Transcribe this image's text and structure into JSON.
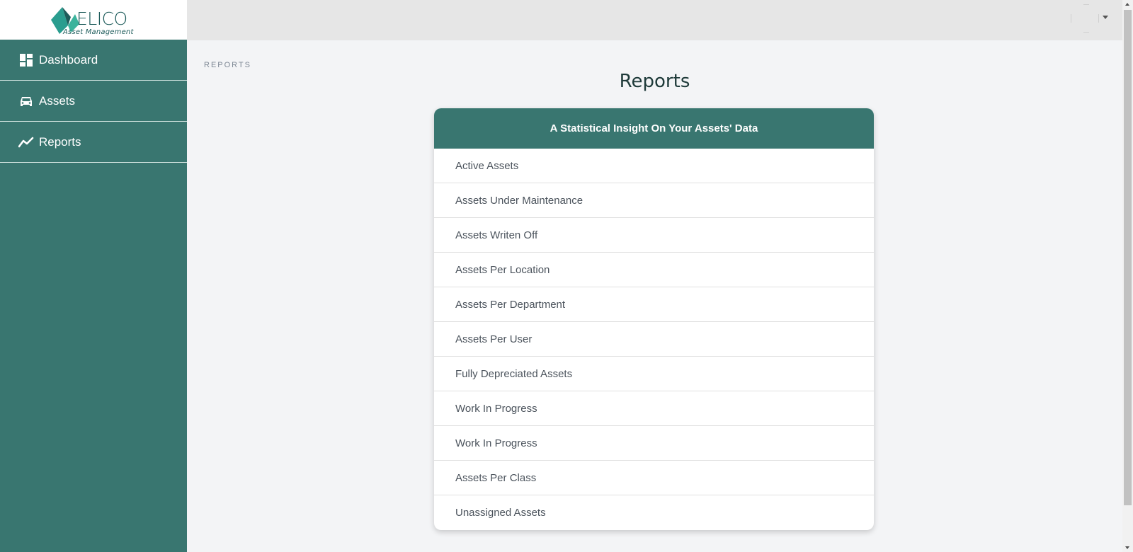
{
  "logo": {
    "word": "ELICO",
    "subtitle": "Asset Management"
  },
  "sidebar": {
    "items": [
      {
        "label": "Dashboard",
        "icon": "dashboard-icon"
      },
      {
        "label": "Assets",
        "icon": "car-icon"
      },
      {
        "label": "Reports",
        "icon": "trend-line-icon"
      }
    ]
  },
  "breadcrumb": "REPORTS",
  "page": {
    "title": "Reports"
  },
  "card": {
    "header": "A Statistical Insight On Your Assets' Data",
    "items": [
      "Active Assets",
      "Assets Under Maintenance",
      "Assets Writen Off",
      "Assets Per Location",
      "Assets Per Department",
      "Assets Per User",
      "Fully Depreciated Assets",
      "Work In Progress",
      "Work In Progress",
      "Assets Per Class",
      "Unassigned Assets"
    ]
  },
  "colors": {
    "accent": "#397670",
    "topbar": "#e6e6e6",
    "background": "#f3f4f6"
  }
}
